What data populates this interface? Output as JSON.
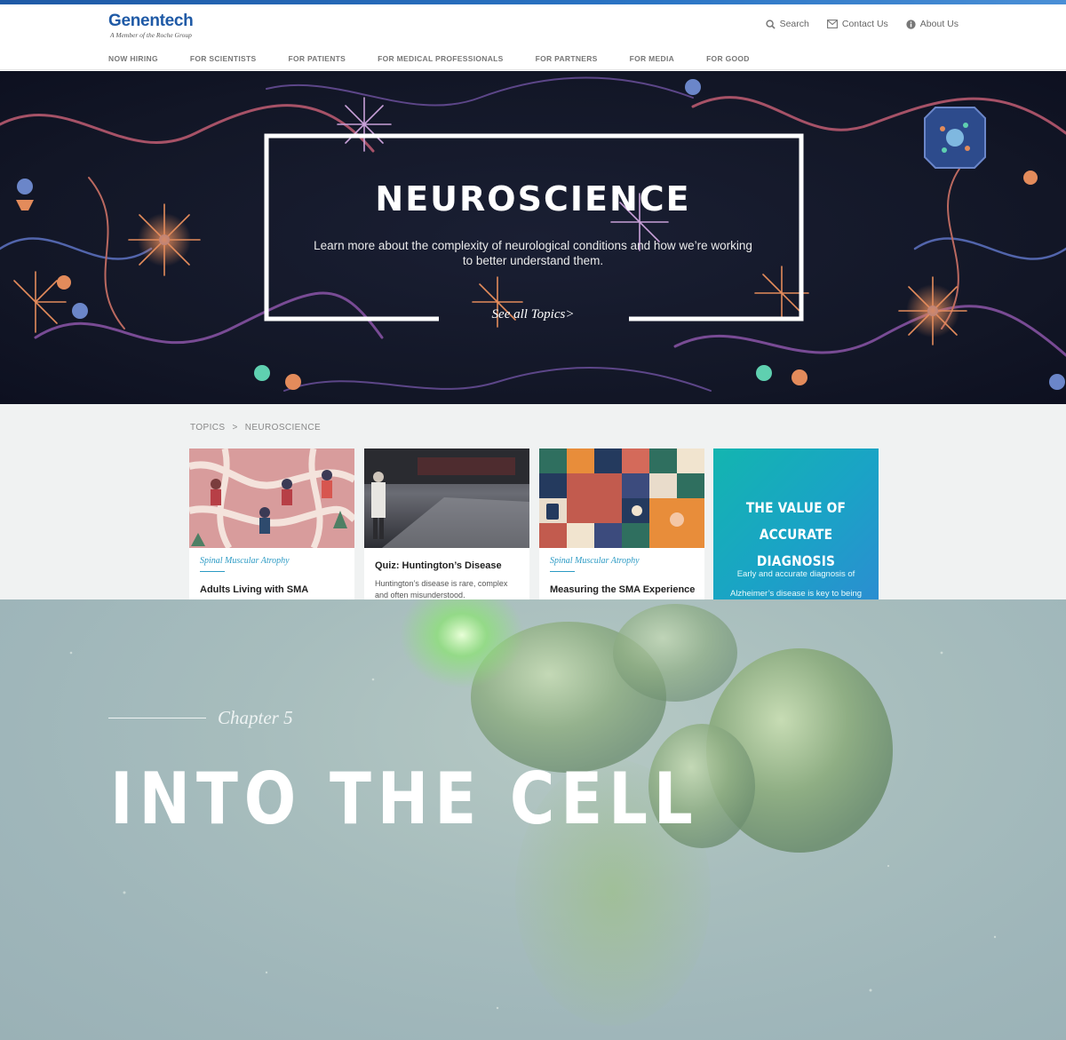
{
  "brand": {
    "name": "Genentech",
    "tagline": "A Member of the Roche Group"
  },
  "utility_nav": [
    {
      "label": "Search",
      "icon": "search-icon"
    },
    {
      "label": "Contact Us",
      "icon": "mail-icon"
    },
    {
      "label": "About Us",
      "icon": "info-icon"
    }
  ],
  "main_nav": [
    "NOW HIRING",
    "FOR SCIENTISTS",
    "FOR PATIENTS",
    "FOR MEDICAL PROFESSIONALS",
    "FOR PARTNERS",
    "FOR MEDIA",
    "FOR GOOD"
  ],
  "hero": {
    "title": "NEUROSCIENCE",
    "subtitle": "Learn more about the complexity of neurological conditions and how we’re working to better understand them.",
    "link": "See all Topics>"
  },
  "breadcrumb": {
    "parent": "TOPICS",
    "separator": ">",
    "current": "NEUROSCIENCE"
  },
  "cards": [
    {
      "category": "Spinal Muscular Atrophy",
      "title": "Adults Living with SMA",
      "description": ""
    },
    {
      "category": "",
      "title": "Quiz: Huntington’s Disease",
      "description": "Huntington’s disease is rare, complex and often misunderstood."
    },
    {
      "category": "Spinal Muscular Atrophy",
      "title": "Measuring the SMA Experience",
      "description": ""
    },
    {
      "title_line1": "THE VALUE OF",
      "title_line2": "ACCURATE DIAGNOSIS",
      "description": "Early and accurate diagnosis of Alzheimer’s disease is key to being"
    }
  ],
  "chapter": {
    "label": "Chapter 5",
    "title": "INTO THE CELL"
  },
  "colors": {
    "brand_blue": "#1f5aa6",
    "category_blue": "#2b9ac4",
    "teal": "#1aa3c6"
  }
}
